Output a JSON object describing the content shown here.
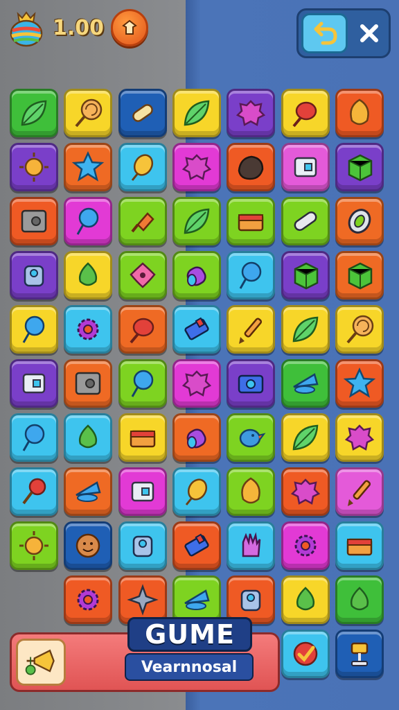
{
  "hud": {
    "coins": "1.00",
    "icons": {
      "bag": "coin-bag-icon",
      "shop": "shop-icon",
      "undo": "undo-icon",
      "close": "close-icon"
    }
  },
  "board": {
    "rows": [
      [
        {
          "color": "#3fbf3a",
          "icon": "leaf"
        },
        {
          "color": "#f7d629",
          "icon": "lollipop"
        },
        {
          "color": "#1f5fb5",
          "icon": "bone"
        },
        {
          "color": "#f7d629",
          "icon": "leaf"
        },
        {
          "color": "#7a3fc9",
          "icon": "blob"
        },
        {
          "color": "#f7d629",
          "icon": "candy"
        },
        {
          "color": "#ef5a24",
          "icon": "gem"
        }
      ],
      [
        {
          "color": "#7a3fc9",
          "icon": "sun"
        },
        {
          "color": "#ef6a24",
          "icon": "star"
        },
        {
          "color": "#3ec4ee",
          "icon": "bean"
        },
        {
          "color": "#e23ad5",
          "icon": "blob"
        },
        {
          "color": "#ef5a24",
          "icon": "rock"
        },
        {
          "color": "#e45ad9",
          "icon": "box"
        },
        {
          "color": "#7a3fc9",
          "icon": "cube"
        }
      ],
      [
        {
          "color": "#ef5a24",
          "icon": "safe"
        },
        {
          "color": "#e23ad5",
          "icon": "balloon"
        },
        {
          "color": "#7ed321",
          "icon": "bottle"
        },
        {
          "color": "#7ed321",
          "icon": "leaf"
        },
        {
          "color": "#7ed321",
          "icon": "chest"
        },
        {
          "color": "#7ed321",
          "icon": "capsule"
        },
        {
          "color": "#ef6a24",
          "icon": "ring"
        }
      ],
      [
        {
          "color": "#7a3fc9",
          "icon": "robot"
        },
        {
          "color": "#f7d629",
          "icon": "drop"
        },
        {
          "color": "#7ed321",
          "icon": "flower"
        },
        {
          "color": "#7ed321",
          "icon": "can"
        },
        {
          "color": "#3ec4ee",
          "icon": "balloon"
        },
        {
          "color": "#7a3fc9",
          "icon": "cube"
        },
        {
          "color": "#ef6a24",
          "icon": "cube"
        }
      ],
      [
        {
          "color": "#f7d629",
          "icon": "balloon"
        },
        {
          "color": "#3ec4ee",
          "icon": "gear"
        },
        {
          "color": "#ef6a24",
          "icon": "candy"
        },
        {
          "color": "#3ec4ee",
          "icon": "battery"
        },
        {
          "color": "#f7d629",
          "icon": "brush"
        },
        {
          "color": "#f7d629",
          "icon": "leaf"
        },
        {
          "color": "#f7d629",
          "icon": "lollipop"
        }
      ],
      [
        {
          "color": "#7a3fc9",
          "icon": "box"
        },
        {
          "color": "#ef6a24",
          "icon": "safe"
        },
        {
          "color": "#7ed321",
          "icon": "balloon"
        },
        {
          "color": "#e23ad5",
          "icon": "blob"
        },
        {
          "color": "#7a3fc9",
          "icon": "camera"
        },
        {
          "color": "#3fbf3a",
          "icon": "cone"
        },
        {
          "color": "#ef5a24",
          "icon": "star"
        }
      ],
      [
        {
          "color": "#3ec4ee",
          "icon": "balloon"
        },
        {
          "color": "#3ec4ee",
          "icon": "drop"
        },
        {
          "color": "#f7d629",
          "icon": "chest"
        },
        {
          "color": "#ef6a24",
          "icon": "can"
        },
        {
          "color": "#7ed321",
          "icon": "bird"
        },
        {
          "color": "#f7d629",
          "icon": "leaf"
        },
        {
          "color": "#f7d629",
          "icon": "blob"
        }
      ],
      [
        {
          "color": "#3ec4ee",
          "icon": "bell"
        },
        {
          "color": "#ef6a24",
          "icon": "cone"
        },
        {
          "color": "#e23ad5",
          "icon": "box"
        },
        {
          "color": "#3ec4ee",
          "icon": "bean"
        },
        {
          "color": "#7ed321",
          "icon": "gem"
        },
        {
          "color": "#ef5a24",
          "icon": "blob"
        },
        {
          "color": "#e45ad9",
          "icon": "brush"
        }
      ],
      [
        {
          "color": "#7ed321",
          "icon": "sun"
        },
        {
          "color": "#1f5fb5",
          "icon": "face"
        },
        {
          "color": "#3ec4ee",
          "icon": "robot"
        },
        {
          "color": "#ef5a24",
          "icon": "battery"
        },
        {
          "color": "#3ec4ee",
          "icon": "hand"
        },
        {
          "color": "#e23ad5",
          "icon": "gear"
        },
        {
          "color": "#3ec4ee",
          "icon": "chest"
        }
      ],
      [
        null,
        {
          "color": "#ef5a24",
          "icon": "gear"
        },
        {
          "color": "#ef5a24",
          "icon": "spinner"
        },
        {
          "color": "#7ed321",
          "icon": "cone"
        },
        {
          "color": "#ef5a24",
          "icon": "robot"
        },
        {
          "color": "#f7d629",
          "icon": "drop"
        },
        {
          "color": "#3fbf3a",
          "icon": "drop"
        }
      ]
    ],
    "extra_row": [
      {
        "color": "#3ec4ee",
        "icon": "check"
      },
      {
        "color": "#1f5fb5",
        "icon": "lamp"
      }
    ]
  },
  "footer": {
    "logo_title": "GUME",
    "logo_subtitle": "Vearnnosal",
    "booster_icon": "trumpet-icon"
  }
}
